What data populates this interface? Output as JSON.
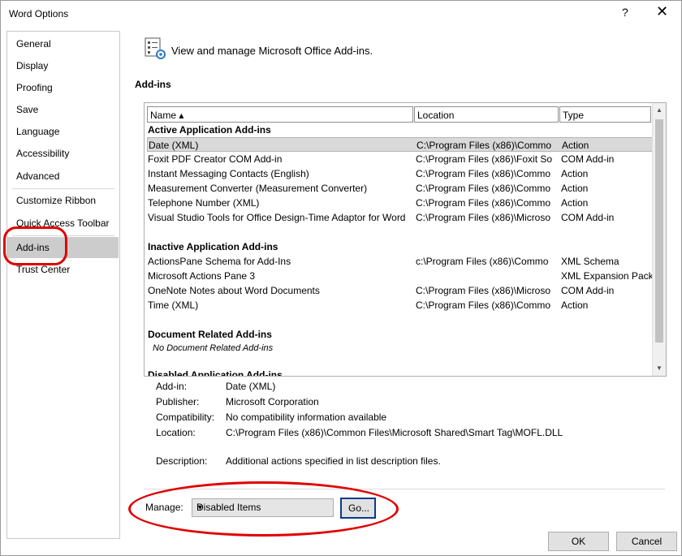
{
  "window": {
    "title": "Word Options",
    "help": "?",
    "close": "✕"
  },
  "sidebar": {
    "items": [
      "General",
      "Display",
      "Proofing",
      "Save",
      "Language",
      "Accessibility",
      "Advanced",
      "Customize Ribbon",
      "Quick Access Toolbar",
      "Add-ins",
      "Trust Center"
    ],
    "selected": "Add-ins"
  },
  "header": {
    "text": "View and manage Microsoft Office Add-ins.",
    "section": "Add-ins"
  },
  "list": {
    "columns": [
      "Name ▴",
      "Location",
      "Type"
    ],
    "groups": {
      "active": {
        "title": "Active Application Add-ins",
        "rows": [
          {
            "name": "Date (XML)",
            "location": "C:\\Program Files (x86)\\Commo",
            "type": "Action"
          },
          {
            "name": "Foxit PDF Creator COM Add-in",
            "location": "C:\\Program Files (x86)\\Foxit So",
            "type": "COM Add-in"
          },
          {
            "name": "Instant Messaging Contacts (English)",
            "location": "C:\\Program Files (x86)\\Commo",
            "type": "Action"
          },
          {
            "name": "Measurement Converter (Measurement Converter)",
            "location": "C:\\Program Files (x86)\\Commo",
            "type": "Action"
          },
          {
            "name": "Telephone Number (XML)",
            "location": "C:\\Program Files (x86)\\Commo",
            "type": "Action"
          },
          {
            "name": "Visual Studio Tools for Office Design-Time Adaptor for Word",
            "location": "C:\\Program Files (x86)\\Microso",
            "type": "COM Add-in"
          }
        ]
      },
      "inactive": {
        "title": "Inactive Application Add-ins",
        "rows": [
          {
            "name": "ActionsPane Schema for Add-Ins",
            "location": "c:\\Program Files (x86)\\Commo",
            "type": "XML Schema"
          },
          {
            "name": "Microsoft Actions Pane 3",
            "location": "",
            "type": "XML Expansion Pack"
          },
          {
            "name": "OneNote Notes about Word Documents",
            "location": "C:\\Program Files (x86)\\Microso",
            "type": "COM Add-in"
          },
          {
            "name": "Time (XML)",
            "location": "C:\\Program Files (x86)\\Commo",
            "type": "Action"
          }
        ]
      },
      "document": {
        "title": "Document Related Add-ins",
        "empty": "No Document Related Add-ins"
      },
      "disabled_partial": "Disabled Application Add-ins"
    }
  },
  "details": {
    "addin_label": "Add-in:",
    "addin_value": "Date (XML)",
    "publisher_label": "Publisher:",
    "publisher_value": "Microsoft Corporation",
    "compat_label": "Compatibility:",
    "compat_value": "No compatibility information available",
    "location_label": "Location:",
    "location_value": "C:\\Program Files (x86)\\Common Files\\Microsoft Shared\\Smart Tag\\MOFL.DLL",
    "desc_label": "Description:",
    "desc_value": "Additional actions specified in list description files."
  },
  "manage": {
    "label": "Manage:",
    "selected": "Disabled Items",
    "go": "Go..."
  },
  "footer": {
    "ok": "OK",
    "cancel": "Cancel"
  },
  "annotation_color": "#e00000"
}
